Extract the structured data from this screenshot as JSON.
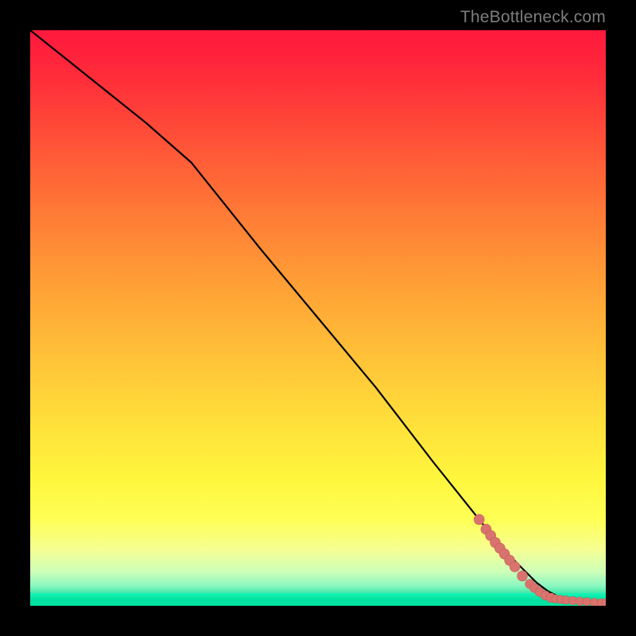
{
  "watermark": "TheBottleneck.com",
  "colors": {
    "frame": "#000000",
    "curve": "#000000",
    "dots": "#d9736d",
    "dot_stroke": "#c95f59"
  },
  "chart_data": {
    "type": "line",
    "title": "",
    "xlabel": "",
    "ylabel": "",
    "xlim": [
      0,
      100
    ],
    "ylim": [
      0,
      100
    ],
    "grid": false,
    "legend": false,
    "series": [
      {
        "name": "curve",
        "x": [
          0,
          10,
          20,
          28,
          40,
          50,
          60,
          70,
          78,
          82,
          86,
          88,
          90,
          92,
          94,
          96,
          98,
          100
        ],
        "y": [
          100,
          92,
          84,
          77,
          62,
          50,
          38,
          25,
          15,
          10,
          6,
          4,
          2.5,
          1.5,
          1,
          0.8,
          0.6,
          0.5
        ]
      }
    ],
    "scatter_points": [
      {
        "x": 78.0,
        "y": 15.0
      },
      {
        "x": 79.2,
        "y": 13.3
      },
      {
        "x": 80.0,
        "y": 12.2
      },
      {
        "x": 80.8,
        "y": 11.0
      },
      {
        "x": 81.6,
        "y": 10.0
      },
      {
        "x": 82.4,
        "y": 9.0
      },
      {
        "x": 83.3,
        "y": 7.9
      },
      {
        "x": 84.2,
        "y": 6.8
      },
      {
        "x": 85.5,
        "y": 5.2
      },
      {
        "x": 86.8,
        "y": 3.8
      },
      {
        "x": 87.6,
        "y": 3.1
      },
      {
        "x": 88.5,
        "y": 2.4
      },
      {
        "x": 89.5,
        "y": 1.8
      },
      {
        "x": 90.5,
        "y": 1.4
      },
      {
        "x": 91.3,
        "y": 1.2
      },
      {
        "x": 92.2,
        "y": 1.1
      },
      {
        "x": 93.1,
        "y": 1.0
      },
      {
        "x": 94.3,
        "y": 0.9
      },
      {
        "x": 95.5,
        "y": 0.8
      },
      {
        "x": 96.7,
        "y": 0.7
      },
      {
        "x": 98.0,
        "y": 0.6
      },
      {
        "x": 99.2,
        "y": 0.5
      },
      {
        "x": 100.0,
        "y": 0.5
      }
    ]
  }
}
